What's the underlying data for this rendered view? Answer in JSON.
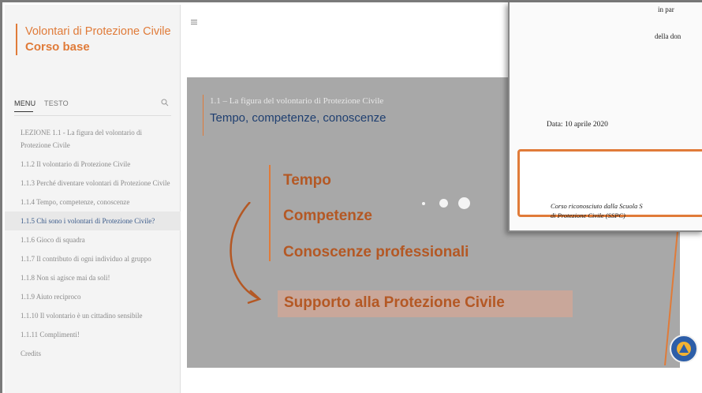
{
  "sidebar": {
    "course_title": "Volontari di Protezione Civile",
    "course_subtitle": "Corso base",
    "tab_menu": "MENU",
    "tab_text": "TESTO",
    "items": [
      {
        "label": "LEZIONE 1.1 - La figura del volontario di Protezione Civile"
      },
      {
        "label": "1.1.2 Il volontario di Protezione Civile"
      },
      {
        "label": "1.1.3 Perché diventare volontari di Protezione Civile"
      },
      {
        "label": "1.1.4 Tempo, competenze, conoscenze"
      },
      {
        "label": "1.1.5 Chi sono i volontari di Protezione Civile?"
      },
      {
        "label": "1.1.6 Gioco di squadra"
      },
      {
        "label": "1.1.7 Il contributo di ogni individuo al gruppo"
      },
      {
        "label": "1.1.8 Non si agisce mai da soli!"
      },
      {
        "label": "1.1.9 Aiuto reciproco"
      },
      {
        "label": "1.1.10 Il volontario è un cittadino sensibile"
      },
      {
        "label": "1.1.11 Complimenti!"
      },
      {
        "label": "Credits"
      }
    ]
  },
  "slide": {
    "subtitle": "1.1 – La figura del volontario di Protezione Civile",
    "title": "Tempo, competenze, conoscenze",
    "keywords": [
      "Tempo",
      "Competenze",
      "Conoscenze professionali"
    ],
    "highlight": "Supporto alla Protezione Civile"
  },
  "document": {
    "line1": "in par",
    "line2": "della don",
    "date": "Data: 10 aprile 2020",
    "box_text_1": "Corso riconosciuto dalla Scuola S",
    "box_text_2": "di Protezione Civile (SSPC)"
  },
  "colors": {
    "accent": "#e07b39",
    "title_blue": "#1f3f70",
    "slide_bg": "#a8a8a8",
    "keyword": "#b45824"
  },
  "icons": {
    "hamburger": "menu-icon",
    "search": "search-icon",
    "logo": "protezione-civile-logo"
  }
}
